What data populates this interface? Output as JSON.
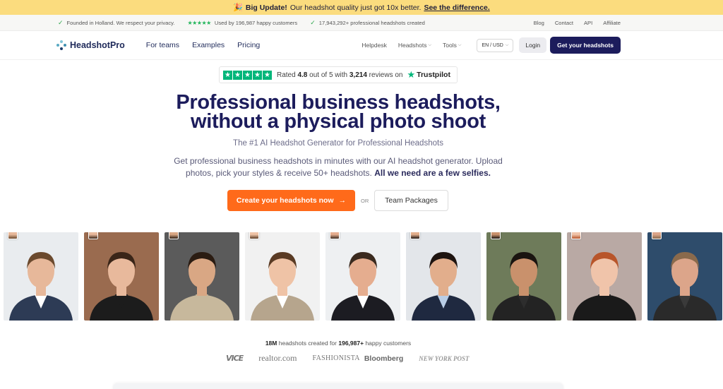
{
  "announcement": {
    "icon": "party-popper-icon",
    "bold": "Big Update!",
    "text": "Our headshot quality just got 10x better.",
    "link": "See the difference."
  },
  "trust_strip": {
    "items": [
      {
        "icon": "check-icon",
        "text": "Founded in Holland. We respect your privacy."
      },
      {
        "icon": "stars-icon",
        "text": "Used by 196,987 happy customers"
      },
      {
        "icon": "check-icon",
        "text": "17,943,292+ professional headshots created"
      }
    ],
    "links": [
      "Blog",
      "Contact",
      "API",
      "Affiliate"
    ]
  },
  "nav": {
    "logo_text": "HeadshotPro",
    "links": [
      "For teams",
      "Examples",
      "Pricing"
    ],
    "right_links": [
      {
        "label": "Helpdesk",
        "dropdown": false
      },
      {
        "label": "Headshots",
        "dropdown": true
      },
      {
        "label": "Tools",
        "dropdown": true
      }
    ],
    "language": "EN / USD",
    "login": "Login",
    "cta": "Get your headshots"
  },
  "trustpilot": {
    "rated_prefix": "Rated",
    "rating": "4.8",
    "out_of": "out of 5 with",
    "reviews": "3,214",
    "reviews_suffix": "reviews on",
    "brand": "Trustpilot",
    "star_color": "#00b67a"
  },
  "hero": {
    "title_line1": "Professional business headshots,",
    "title_line2": "without a physical photo shoot",
    "subtitle": "The #1 AI Headshot Generator for Professional Headshots",
    "para_line1": "Get professional business headshots in minutes with our AI headshot generator. Upload",
    "para_line2": "photos, pick your styles & receive 50+ headshots.",
    "para_bold": "All we need are a few selfies.",
    "cta": "Create your headshots now",
    "cta_color": "#ff6a1a",
    "or": "OR",
    "secondary": "Team Packages"
  },
  "photos": [
    {
      "bg": "#e9ecef",
      "skin": "#e7b89a",
      "hair": "#6b4a2e",
      "cloth": "#2d3b55",
      "shirt": "#ffffff"
    },
    {
      "bg": "#9a6b4f",
      "skin": "#e8b99c",
      "hair": "#3a2518",
      "cloth": "#1c1c1c",
      "shirt": "#1c1c1c"
    },
    {
      "bg": "#5b5b5b",
      "skin": "#d9a784",
      "hair": "#2b1c12",
      "cloth": "#c7b89c",
      "shirt": "#c7b89c"
    },
    {
      "bg": "#f1f1f1",
      "skin": "#efc3a6",
      "hair": "#5a3b24",
      "cloth": "#b6a58d",
      "shirt": "#ffffff"
    },
    {
      "bg": "#eef0f2",
      "skin": "#e5ad8f",
      "hair": "#3b2a1f",
      "cloth": "#1c1c22",
      "shirt": "#ffffff"
    },
    {
      "bg": "#e3e6ea",
      "skin": "#e2ae8c",
      "hair": "#1e1410",
      "cloth": "#1f2940",
      "shirt": "#b9cde6"
    },
    {
      "bg": "#6e7b5a",
      "skin": "#c9916c",
      "hair": "#1a1410",
      "cloth": "#232323",
      "shirt": "#2d2d2d"
    },
    {
      "bg": "#b9a9a4",
      "skin": "#f0c4aa",
      "hair": "#b8552a",
      "cloth": "#1a1a1a",
      "shirt": "#1a1a1a"
    },
    {
      "bg": "#2e4c6b",
      "skin": "#dca58a",
      "hair": "#8a6a4c",
      "cloth": "#2a2a2a",
      "shirt": "#3a3a3a"
    }
  ],
  "bottom": {
    "count_prefix": "18M",
    "count_mid": "headshots created for",
    "count_customers": "196,987+",
    "count_suffix": "happy customers",
    "press": [
      "VICE",
      "realtor.com",
      "FASHIONISTA",
      "Bloomberg",
      "NEW YORK POST"
    ]
  }
}
